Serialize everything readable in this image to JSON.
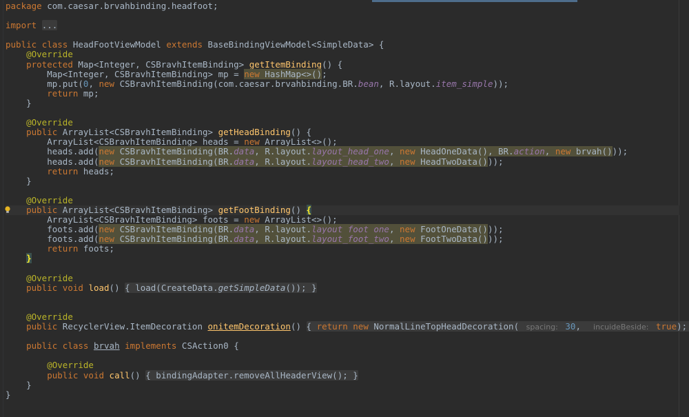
{
  "editor": {
    "colors": {
      "background": "#2b2b2b",
      "text": "#a9b7c6",
      "keyword": "#cc7832",
      "annotation": "#bbb529",
      "method": "#ffc66d",
      "number": "#6897bb",
      "field": "#9876aa"
    }
  },
  "code": {
    "package_kw": "package",
    "package_name": " com.caesar.brvahbinding.headfoot;",
    "import_kw": "import",
    "import_fold": "...",
    "public_kw": "public",
    "class_kw": "class",
    "class_name": " HeadFootViewModel ",
    "extends_kw": "extends",
    "base_class": " BaseBindingViewModel<SimpleData> {",
    "override": "@Override",
    "protected_kw": "protected",
    "map_type": " Map<Integer, CSBravhItemBinding> ",
    "get_item_binding": "getItemBinding",
    "empty_open": "() {",
    "map_decl": "Map<Integer, CSBravhItemBinding> mp = ",
    "new_kw": "new",
    "hashmap": " HashMap<>()",
    "semicolon": ";",
    "mp_put_a": "mp.put(",
    "zero": "0",
    "comma_space": ", ",
    "cs_binding_a": " CSBravhItemBinding(com.caesar.brvahbinding.BR.",
    "bean": "bean",
    "rlayout": ", R.layout.",
    "item_simple": "item_simple",
    "close_paren_semi": "));",
    "return_kw": "return",
    "return_mp": " mp;",
    "close_brace": "}",
    "arraylist_type": " ArrayList<CSBravhItemBinding> ",
    "get_head_binding": "getHeadBinding",
    "heads_decl": "ArrayList<CSBravhItemBinding> heads = ",
    "new_arraylist": " ArrayList<>();",
    "heads_add": "heads.add(",
    "cs_binding_br": " CSBravhItemBinding(BR.",
    "data": "data",
    "layout_head_one": "layout_head_one",
    "head_one_data": " HeadOneData(), BR.",
    "action": "action",
    "brvah_call": " brvah()",
    "close_two": "));",
    "layout_head_two": "layout_head_two",
    "head_two_data": " HeadTwoData()",
    "return_heads": " heads;",
    "get_foot_binding": "getFootBinding",
    "open_brace_sp": "() ",
    "open_brace": "{",
    "foots_decl": "ArrayList<CSBravhItemBinding> foots = ",
    "foots_add": "foots.add(",
    "layout_foot_one": "layout_foot_one",
    "foot_one_data": " FootOneData()",
    "layout_foot_two": "layout_foot_two",
    "foot_two_data": " FootTwoData()",
    "return_foots": " foots;",
    "void_kw": "void",
    "load": "load",
    "load_fold_a": "{ load(CreateData.",
    "get_simple_data": "getSimpleData",
    "load_fold_b": "()); }",
    "recycler_type": " RecyclerView.ItemDecoration ",
    "on_item_decoration": "onitemDecoration",
    "decor_fold_a": "{ ",
    "normal_line": " NormalLineTopHeadDecoration(",
    "hint_spacing": "spacing:",
    "thirty": "30",
    "hint_beside": "incuideBeside:",
    "true_kw": "true",
    "decor_fold_b": "); }",
    "brvah_class": "brvah",
    "implements_kw": "implements",
    "csaction": " CSAction0 {",
    "call": "call",
    "call_fold": "{ bindingAdapter.removeAllHeaderView(); }",
    "parens": "()"
  }
}
